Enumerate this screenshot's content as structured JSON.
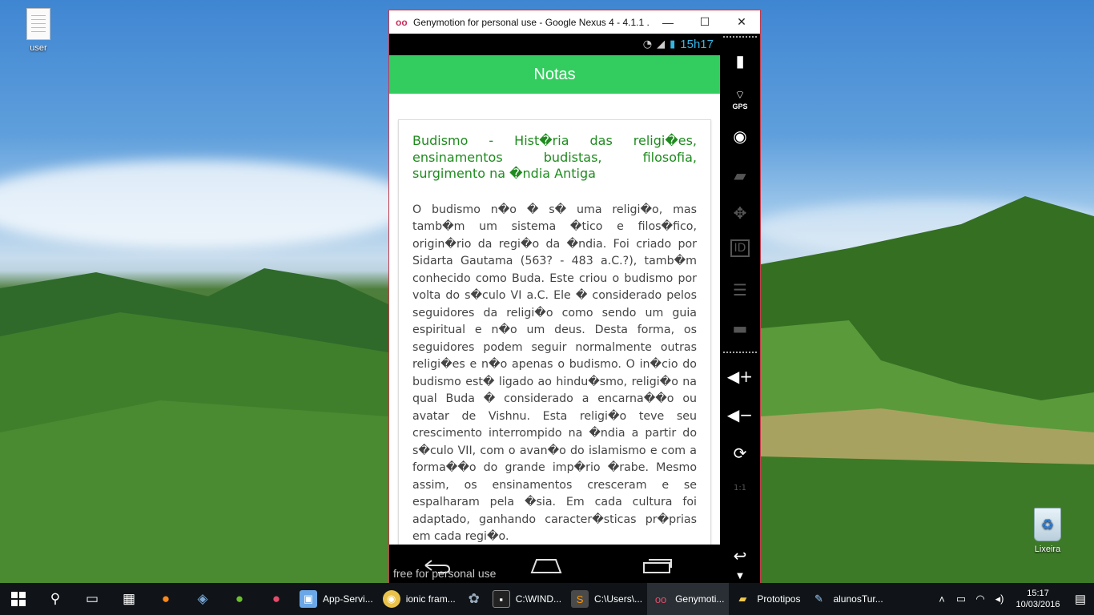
{
  "desktop": {
    "icons": [
      {
        "label": "user",
        "icon": "document-icon"
      },
      {
        "label": "Lixeira",
        "icon": "recycle-bin-icon"
      }
    ]
  },
  "window": {
    "title": "Genymotion for personal use - Google Nexus 4 - 4.1.1 ...",
    "controls": {
      "minimize": "—",
      "maximize": "☐",
      "close": "✕"
    }
  },
  "device": {
    "status_time": "15h17",
    "app_title": "Notas",
    "note": {
      "title": "Budismo - Hist�ria das religi�es, ensinamentos budistas, filosofia, surgimento na �ndia Antiga",
      "body": "O budismo n�o � s� uma religi�o, mas tamb�m um sistema �tico e filos�fico, origin�rio da regi�o da �ndia. Foi criado por Sidarta Gautama (563? - 483 a.C.?), tamb�m conhecido como Buda. Este criou o budismo por volta do s�culo VI a.C. Ele � considerado pelos seguidores da religi�o como sendo um guia espiritual e n�o um deus. Desta forma, os seguidores podem seguir normalmente outras religi�es e n�o apenas o budismo. O in�cio do budismo est� ligado ao hindu�smo, religi�o na qual Buda � considerado a encarna��o ou avatar de Vishnu. Esta religi�o teve seu crescimento interrompido na �ndia a partir do s�culo VII, com o avan�o do islamismo e com a forma��o do grande imp�rio �rabe. Mesmo assim, os ensinamentos cresceram e se espalharam pela �sia. Em cada cultura foi adaptado, ganhando caracter�sticas pr�prias em cada regi�o."
    },
    "watermark": "free for personal use"
  },
  "sidepanel": {
    "gps_label": "GPS",
    "id_label": "ID",
    "scale_label": "1:1"
  },
  "taskbar": {
    "apps": [
      {
        "label": "App-Servi...",
        "icon": "box-icon"
      },
      {
        "label": "ionic fram...",
        "icon": "chrome-icon"
      },
      {
        "label": "C:\\WIND...",
        "icon": "cmd-icon"
      },
      {
        "label": "C:\\Users\\...",
        "icon": "sublime-icon"
      },
      {
        "label": "Genymoti...",
        "icon": "genymotion-icon"
      },
      {
        "label": "Prototipos",
        "icon": "folder-icon"
      },
      {
        "label": "alunosTur...",
        "icon": "paint-icon"
      }
    ],
    "clock_time": "15:17",
    "clock_date": "10/03/2016"
  }
}
